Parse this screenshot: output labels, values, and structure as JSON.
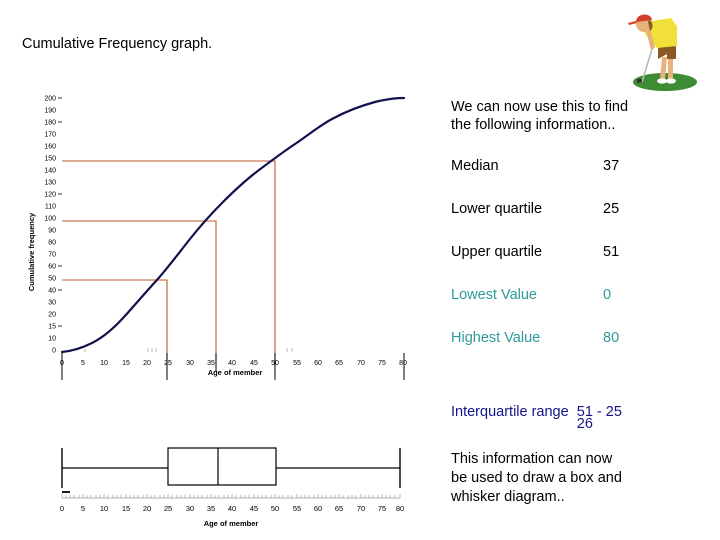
{
  "slide": {
    "title": "Cumulative Frequency graph.",
    "intro_line1": "We can now use this to find",
    "intro_line2": "the following information..",
    "closing_line1": "This information can now",
    "closing_line2": "be used to draw a box and",
    "closing_line3": "whisker diagram.."
  },
  "colors": {
    "curve": "#11114f",
    "construction_line": "#c05a26",
    "teal_text": "#2f9999",
    "navy_text": "#13138c",
    "axis": "#000000",
    "golfer_shirt": "#f2e03a",
    "golfer_shorts": "#8a5a22",
    "golfer_cap": "#d4412a",
    "golfer_skin": "#e8b07a",
    "golfer_green": "#3d8b33"
  },
  "stats": [
    {
      "label": "Median",
      "value": "37",
      "style": "black"
    },
    {
      "label": "Lower quartile",
      "value": "25",
      "style": "black"
    },
    {
      "label": "Upper quartile",
      "value": "51",
      "style": "black"
    },
    {
      "label": "Lowest Value",
      "value": "0",
      "style": "teal"
    },
    {
      "label": "Highest Value",
      "value": "80",
      "style": "teal"
    }
  ],
  "iqr": {
    "label": "Interquartile range",
    "expression": "51 - 25",
    "answer": "26"
  },
  "chart_data": {
    "type": "line",
    "title": "Cumulative Frequency graph.",
    "xlabel": "Age of member",
    "ylabel": "Cumulative frequency",
    "xlim": [
      0,
      80
    ],
    "ylim": [
      0,
      200
    ],
    "xticks": [
      0,
      5,
      10,
      15,
      20,
      25,
      30,
      35,
      40,
      45,
      50,
      55,
      60,
      65,
      70,
      75,
      80
    ],
    "yticks": [
      0,
      10,
      20,
      30,
      40,
      50,
      60,
      70,
      80,
      90,
      100,
      110,
      120,
      130,
      140,
      150,
      160,
      170,
      180,
      190,
      200
    ],
    "grid": false,
    "legend": "none",
    "series": [
      {
        "name": "Cumulative frequency",
        "x": [
          0,
          5,
          10,
          15,
          20,
          25,
          30,
          35,
          40,
          45,
          50,
          55,
          60,
          65,
          70,
          75,
          80
        ],
        "y": [
          0,
          4,
          10,
          20,
          33,
          50,
          70,
          90,
          112,
          132,
          148,
          164,
          176,
          186,
          193,
          197,
          200
        ]
      }
    ],
    "annotations": [
      {
        "name": "lower-quartile-construction",
        "x": 25,
        "y": 50,
        "label": "Lower quartile 25"
      },
      {
        "name": "median-construction",
        "x": 37,
        "y": 100,
        "label": "Median 37"
      },
      {
        "name": "upper-quartile-construction",
        "x": 51,
        "y": 150,
        "label": "Upper quartile 51"
      }
    ]
  },
  "boxplot_data": {
    "type": "boxplot",
    "xlabel": "Age of member",
    "xlim": [
      0,
      80
    ],
    "xticks": [
      0,
      5,
      10,
      15,
      20,
      25,
      30,
      35,
      40,
      45,
      50,
      55,
      60,
      65,
      70,
      75,
      80
    ],
    "min": 0,
    "q1": 25,
    "median": 37,
    "q3": 51,
    "max": 80
  }
}
